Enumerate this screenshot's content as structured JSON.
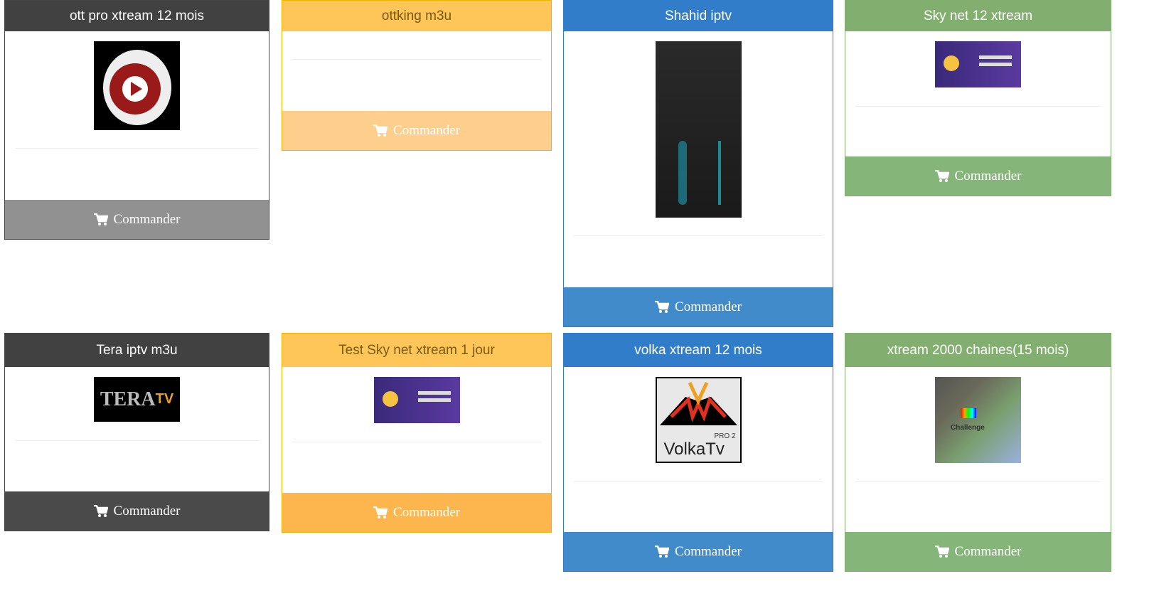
{
  "button_label": "Commander",
  "cards": [
    {
      "title": "ott pro xtream 12 mois",
      "image": "ott-pro-logo",
      "header_color": "#414141",
      "button_color": "#919191"
    },
    {
      "title": "ottking m3u",
      "image": "",
      "header_color": "#fec558",
      "button_color": "#fecf8c"
    },
    {
      "title": "Shahid iptv",
      "image": "shahid-login-screenshot",
      "header_color": "#317dc9",
      "button_color": "#428bca"
    },
    {
      "title": "Sky net 12 xtream",
      "image": "sky-net-login-screenshot",
      "header_color": "#82ae6f",
      "button_color": "#86b57a"
    },
    {
      "title": "Tera iptv m3u",
      "image": "tera-pro-tv-logo",
      "header_color": "#414141",
      "button_color": "#4a4a4a"
    },
    {
      "title": "Test Sky net xtream 1 jour",
      "image": "sky-net-login-screenshot",
      "header_color": "#fec558",
      "button_color": "#fdb54e"
    },
    {
      "title": "volka xtream 12 mois",
      "image": "volka-tv-pro-2-logo",
      "header_color": "#317dc9",
      "button_color": "#428bca"
    },
    {
      "title": "xtream 2000 chaines(15 mois)",
      "image": "challenge-tv-logo",
      "header_color": "#82ae6f",
      "button_color": "#86b57a"
    }
  ],
  "image_text": {
    "volka": "VolkaTv",
    "volka_sub": "PRO 2",
    "challenge": "Challenge",
    "tera": "TERA"
  }
}
